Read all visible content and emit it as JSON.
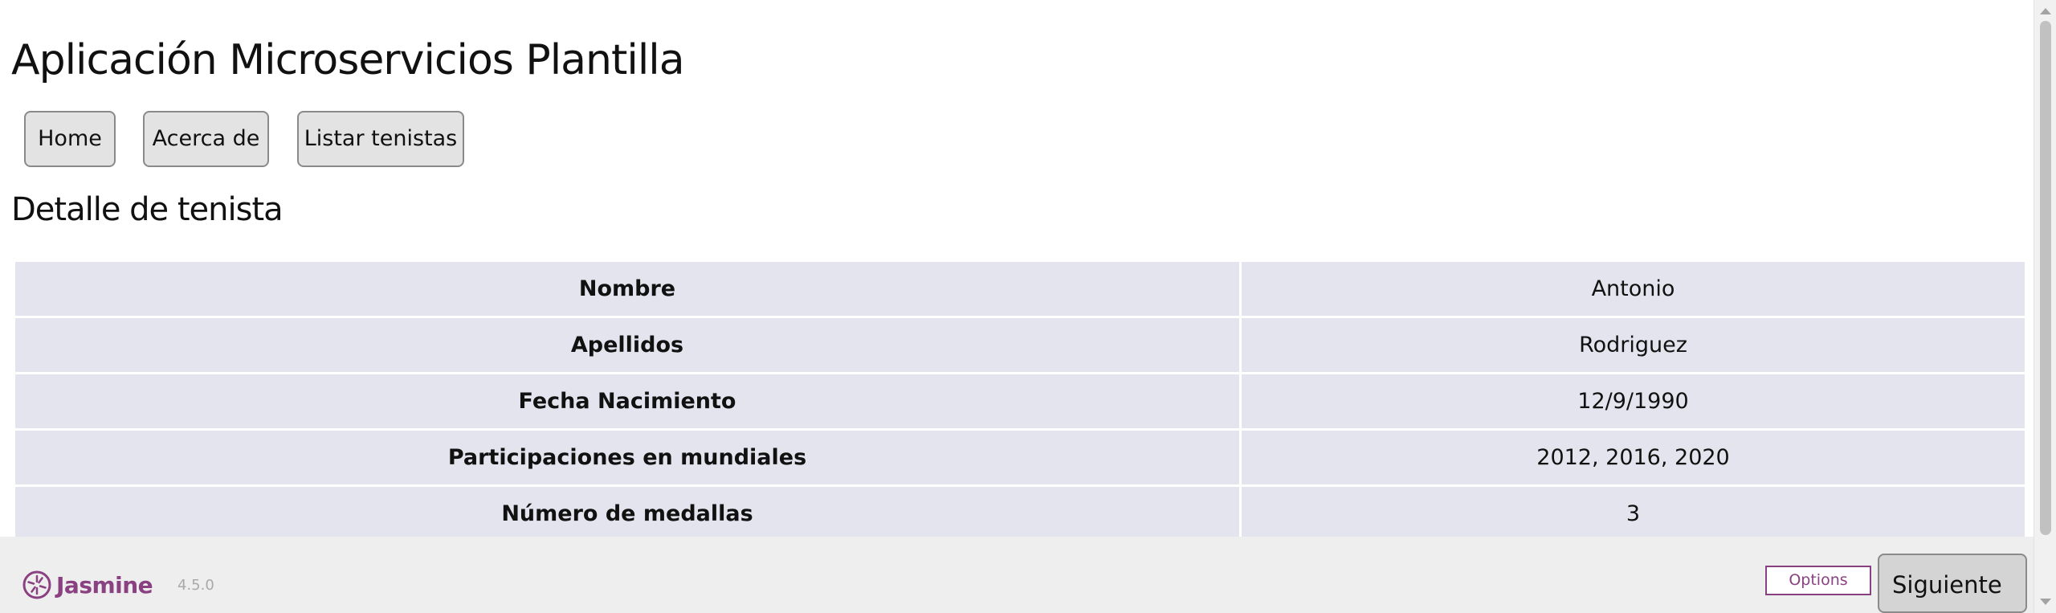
{
  "app": {
    "title": "Aplicación Microservicios Plantilla"
  },
  "nav": {
    "items": [
      {
        "label": "Home"
      },
      {
        "label": "Acerca de"
      },
      {
        "label": "Listar tenistas"
      }
    ]
  },
  "section": {
    "title": "Detalle de tenista"
  },
  "detail": {
    "rows": [
      {
        "key": "Nombre",
        "value": "Antonio"
      },
      {
        "key": "Apellidos",
        "value": "Rodriguez"
      },
      {
        "key": "Fecha Nacimiento",
        "value": "12/9/1990"
      },
      {
        "key": "Participaciones en mundiales",
        "value": "2012, 2016, 2020"
      },
      {
        "key": "Número de medallas",
        "value": "3"
      }
    ]
  },
  "jasmine": {
    "brand": "Jasmine",
    "version": "4.5.0",
    "options_label": "Options",
    "brand_color": "#8a4182"
  },
  "footer": {
    "next_label": "Siguiente"
  },
  "icons": {
    "logo": "jasmine-flower-icon"
  }
}
